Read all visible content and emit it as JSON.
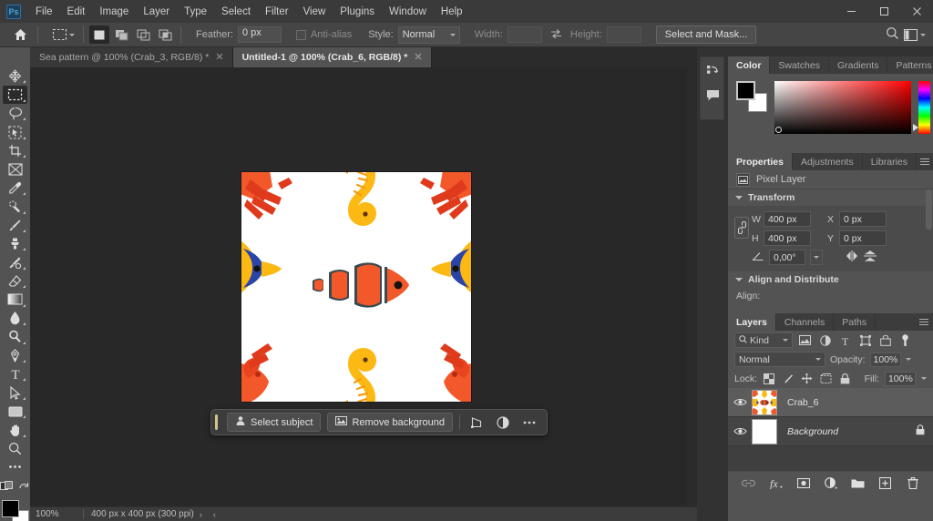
{
  "app": {
    "name": "Adobe Photoshop",
    "logo_text": "Ps"
  },
  "menubar": {
    "items": [
      {
        "label": "File"
      },
      {
        "label": "Edit"
      },
      {
        "label": "Image"
      },
      {
        "label": "Layer"
      },
      {
        "label": "Type"
      },
      {
        "label": "Select"
      },
      {
        "label": "Filter"
      },
      {
        "label": "View"
      },
      {
        "label": "Plugins"
      },
      {
        "label": "Window"
      },
      {
        "label": "Help"
      }
    ],
    "window_controls": {
      "minimize": "─",
      "maximize": "□",
      "close": "✕"
    }
  },
  "options_bar": {
    "home_icon": "home-icon",
    "active_tool_icon": "rectangular-marquee-icon",
    "selection_modes": [
      {
        "name": "new-selection",
        "active": true
      },
      {
        "name": "add-to-selection",
        "active": false
      },
      {
        "name": "subtract-from-selection",
        "active": false
      },
      {
        "name": "intersect-with-selection",
        "active": false
      }
    ],
    "feather_label": "Feather:",
    "feather_value": "0 px",
    "antialias_label": "Anti-alias",
    "antialias_checked": false,
    "style_label": "Style:",
    "style_value": "Normal",
    "width_label": "Width:",
    "width_value": "",
    "swap_icon": "swap-width-height-icon",
    "height_label": "Height:",
    "height_value": "",
    "select_and_mask_label": "Select and Mask...",
    "search_icon": "search-icon",
    "workspace_icon": "workspace-switcher-icon"
  },
  "tabs": [
    {
      "label": "Sea pattern @ 100% (Crab_3, RGB/8) *",
      "active": false,
      "close": "✕"
    },
    {
      "label": "Untitled-1 @ 100% (Crab_6, RGB/8) *",
      "active": true,
      "close": "✕"
    }
  ],
  "toolbar": {
    "tools": [
      {
        "name": "move-tool",
        "selected": false,
        "has_flyout": true
      },
      {
        "name": "rectangular-marquee-tool",
        "selected": true,
        "has_flyout": true
      },
      {
        "name": "lasso-tool",
        "selected": false,
        "has_flyout": true
      },
      {
        "name": "object-selection-tool",
        "selected": false,
        "has_flyout": true
      },
      {
        "name": "crop-tool",
        "selected": false,
        "has_flyout": true
      },
      {
        "name": "frame-tool",
        "selected": false,
        "has_flyout": false
      },
      {
        "name": "eyedropper-tool",
        "selected": false,
        "has_flyout": true
      },
      {
        "name": "spot-healing-brush-tool",
        "selected": false,
        "has_flyout": true
      },
      {
        "name": "brush-tool",
        "selected": false,
        "has_flyout": true
      },
      {
        "name": "clone-stamp-tool",
        "selected": false,
        "has_flyout": true
      },
      {
        "name": "history-brush-tool",
        "selected": false,
        "has_flyout": true
      },
      {
        "name": "eraser-tool",
        "selected": false,
        "has_flyout": true
      },
      {
        "name": "gradient-tool",
        "selected": false,
        "has_flyout": true
      },
      {
        "name": "blur-tool",
        "selected": false,
        "has_flyout": true
      },
      {
        "name": "dodge-tool",
        "selected": false,
        "has_flyout": true
      },
      {
        "name": "pen-tool",
        "selected": false,
        "has_flyout": true
      },
      {
        "name": "type-tool",
        "selected": false,
        "has_flyout": true
      },
      {
        "name": "path-selection-tool",
        "selected": false,
        "has_flyout": true
      },
      {
        "name": "rectangle-tool",
        "selected": false,
        "has_flyout": true
      },
      {
        "name": "hand-tool",
        "selected": false,
        "has_flyout": true
      },
      {
        "name": "zoom-tool",
        "selected": false,
        "has_flyout": false
      },
      {
        "name": "edit-toolbar-tool",
        "selected": false,
        "has_flyout": false
      }
    ],
    "quick_mask_icon": "quick-mask-icon",
    "screen_mode_icon": "screen-mode-icon",
    "foreground_color": "#000000",
    "background_color": "#ffffff"
  },
  "canvas": {
    "document_title": "Untitled-1",
    "zoom": "100%",
    "artwork": {
      "description": "Seamless sea-life pattern: clownfish, yellow butterflyfish, seahorses, crabs and lobsters on white",
      "background": "#ffffff",
      "palette": {
        "orange": "#f2582a",
        "deep_orange": "#e8441e",
        "yellow": "#fcb813",
        "amber": "#f59a12",
        "blue": "#2b44a8",
        "dark": "#384a52",
        "red": "#e03a1c"
      }
    }
  },
  "contextual_taskbar": {
    "select_subject_label": "Select subject",
    "select_subject_icon": "person-select-icon",
    "remove_background_label": "Remove background",
    "remove_background_icon": "image-remove-bg-icon",
    "transform_icon": "transform-icon",
    "adjustment_icon": "adjustment-half-circle-icon",
    "more_icon": "more-options-icon"
  },
  "status_bar": {
    "zoom": "100%",
    "dimensions": "400 px x 400 px (300 ppi)",
    "expand_arrow": "›",
    "collapse_arrow": "‹"
  },
  "icon_rail": {
    "items": [
      {
        "name": "history-icon"
      },
      {
        "name": "comments-icon"
      }
    ]
  },
  "panels": {
    "color_group": {
      "tabs": [
        {
          "label": "Color",
          "active": true
        },
        {
          "label": "Swatches",
          "active": false
        },
        {
          "label": "Gradients",
          "active": false
        },
        {
          "label": "Patterns",
          "active": false
        }
      ],
      "foreground_color": "#000000",
      "background_color": "#ffffff",
      "spectrum": "hue-ramp"
    },
    "properties_group": {
      "tabs": [
        {
          "label": "Properties",
          "active": true
        },
        {
          "label": "Adjustments",
          "active": false
        },
        {
          "label": "Libraries",
          "active": false
        }
      ],
      "layer_type_label": "Pixel Layer",
      "layer_type_icon": "pixel-layer-icon",
      "transform": {
        "section_label": "Transform",
        "link_icon": "link-wh-icon",
        "w_label": "W",
        "w_value": "400 px",
        "x_label": "X",
        "x_value": "0 px",
        "h_label": "H",
        "h_value": "400 px",
        "y_label": "Y",
        "y_value": "0 px",
        "angle_icon": "angle-icon",
        "angle_value": "0,00°",
        "flip_horizontal_icon": "flip-horizontal-icon",
        "flip_vertical_icon": "flip-vertical-icon"
      },
      "align": {
        "section_label": "Align and Distribute",
        "align_label": "Align:"
      }
    },
    "layers_group": {
      "tabs": [
        {
          "label": "Layers",
          "active": true
        },
        {
          "label": "Channels",
          "active": false
        },
        {
          "label": "Paths",
          "active": false
        }
      ],
      "filter": {
        "search_icon": "search-icon",
        "kind_label": "Kind",
        "filter_icons": [
          {
            "name": "filter-pixel-icon"
          },
          {
            "name": "filter-adjustment-icon"
          },
          {
            "name": "filter-type-icon"
          },
          {
            "name": "filter-shape-icon"
          },
          {
            "name": "filter-smart-object-icon"
          }
        ],
        "toggle_icon": "filter-toggle-icon"
      },
      "blend_mode": "Normal",
      "opacity_label": "Opacity:",
      "opacity_value": "100%",
      "lock_label": "Lock:",
      "lock_icons": [
        {
          "name": "lock-transparent-pixels-icon"
        },
        {
          "name": "lock-image-pixels-icon"
        },
        {
          "name": "lock-position-icon"
        },
        {
          "name": "lock-artboard-nesting-icon"
        },
        {
          "name": "lock-all-icon"
        }
      ],
      "fill_label": "Fill:",
      "fill_value": "100%",
      "layers": [
        {
          "name": "Crab_6",
          "visible": true,
          "selected": true,
          "locked": false,
          "italic": false,
          "thumb": "pattern"
        },
        {
          "name": "Background",
          "visible": true,
          "selected": false,
          "locked": true,
          "italic": true,
          "thumb": "white"
        }
      ],
      "footer_icons": [
        {
          "name": "link-layers-icon",
          "dim": true
        },
        {
          "name": "layer-style-fx-icon",
          "dim": false
        },
        {
          "name": "add-layer-mask-icon",
          "dim": false
        },
        {
          "name": "new-adjustment-layer-icon",
          "dim": false
        },
        {
          "name": "new-group-icon",
          "dim": false
        },
        {
          "name": "new-layer-icon",
          "dim": false
        },
        {
          "name": "delete-layer-icon",
          "dim": false
        }
      ]
    }
  }
}
